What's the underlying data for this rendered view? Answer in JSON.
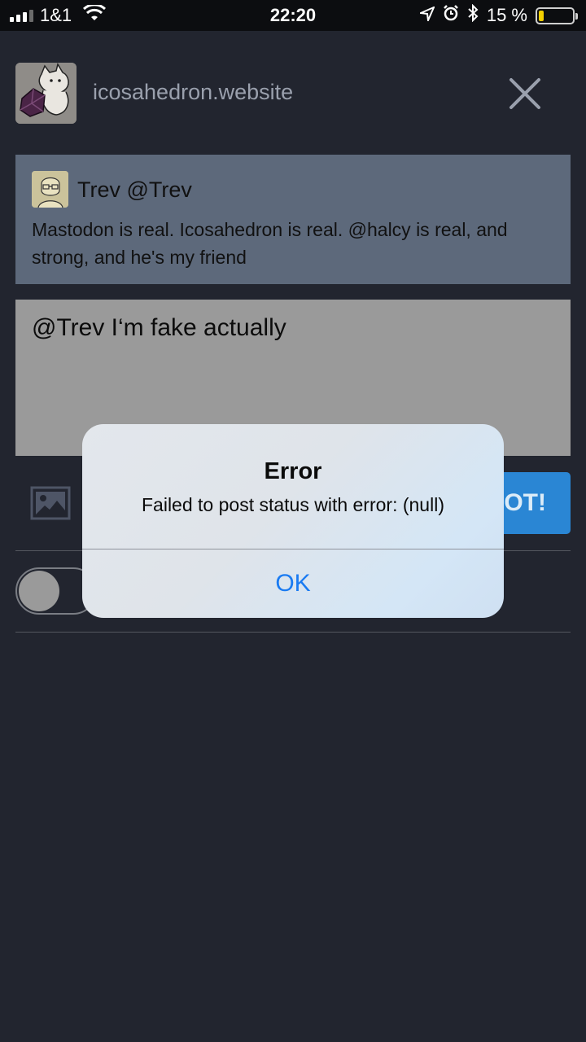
{
  "status_bar": {
    "carrier": "1&1",
    "time": "22:20",
    "battery": "15 %",
    "battery_level": 0.15
  },
  "header": {
    "instance": "icosahedron.website",
    "close_icon": "close-icon"
  },
  "reply_to": {
    "display_name": "Trev",
    "handle": "@Trev",
    "text": "Mastodon is real. Icosahedron is real. @halcy is real, and strong, and he's my friend"
  },
  "compose": {
    "text": "@Trev I‘m fake actually"
  },
  "toolbar": {
    "media_icon": "image-icon",
    "post_label": "OT!"
  },
  "alert": {
    "title": "Error",
    "message": "Failed to post status with error: (null)",
    "ok_label": "OK"
  },
  "colors": {
    "background": "#22252f",
    "reply_card": "#5d697b",
    "compose": "#9a9a9a",
    "post_button": "#2a86d4",
    "alert_action": "#1a7bf2"
  }
}
